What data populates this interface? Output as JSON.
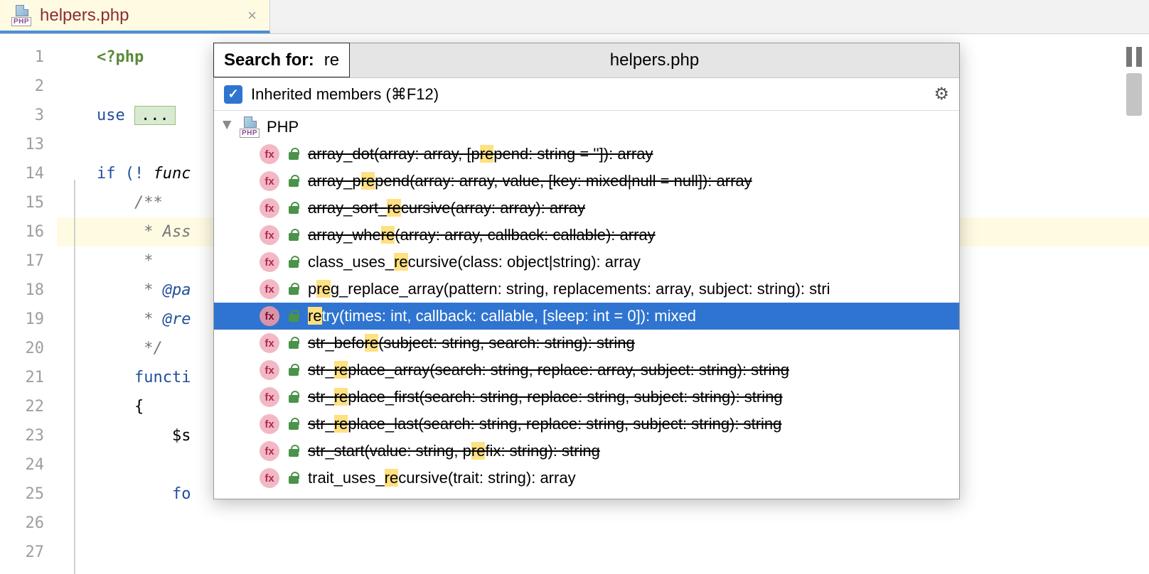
{
  "tab": {
    "filename": "helpers.php",
    "icon_badge": "PHP"
  },
  "gutter_lines": [
    "1",
    "2",
    "3",
    "13",
    "14",
    "15",
    "16",
    "17",
    "18",
    "19",
    "20",
    "21",
    "22",
    "23",
    "24",
    "25",
    "26",
    "27"
  ],
  "code": {
    "l1_tag": "<?php",
    "l3_use": "use ",
    "l3_fold": "...",
    "l14_if": "if (! ",
    "l14_func": "func",
    "l15": "    /**",
    "l16": "     * Ass",
    "l17": "     *",
    "l18_a": "     * ",
    "l18_b": "@pa",
    "l19_a": "     * ",
    "l19_b": "@re",
    "l20": "     */",
    "l21": "    functi",
    "l22": "    {",
    "l23": "        $s",
    "l25": "        fo"
  },
  "popup": {
    "search_label": "Search for:",
    "query": "re",
    "title": "helpers.php",
    "inherited_label": "Inherited members (⌘F12)",
    "tree_root": "PHP",
    "root_badge": "PHP",
    "results": [
      {
        "pre": "array_dot(array: array, [p",
        "hi": "re",
        "post": "pend: string = '']): array",
        "strike": true,
        "selected": false
      },
      {
        "pre": "array_p",
        "hi": "re",
        "post": "pend(array: array, value, [key: mixed|null = null]): array",
        "strike": true,
        "selected": false
      },
      {
        "pre": "array_sort_",
        "hi": "re",
        "post": "cursive(array: array): array",
        "strike": true,
        "selected": false
      },
      {
        "pre": "array_whe",
        "hi": "re",
        "post": "(array: array, callback: callable): array",
        "strike": true,
        "selected": false
      },
      {
        "pre": "class_uses_",
        "hi": "re",
        "post": "cursive(class: object|string): array",
        "strike": false,
        "selected": false
      },
      {
        "pre": "p",
        "hi": "re",
        "post": "g_replace_array(pattern: string, replacements: array, subject: string): stri",
        "strike": false,
        "selected": false
      },
      {
        "pre": "",
        "hi": "re",
        "post": "try(times: int, callback: callable, [sleep: int = 0]): mixed",
        "strike": false,
        "selected": true
      },
      {
        "pre": "str_befo",
        "hi": "re",
        "post": "(subject: string, search: string): string",
        "strike": true,
        "selected": false
      },
      {
        "pre": "str_",
        "hi": "re",
        "post": "place_array(search: string, replace: array, subject: string): string",
        "strike": true,
        "selected": false
      },
      {
        "pre": "str_",
        "hi": "re",
        "post": "place_first(search: string, replace: string, subject: string): string",
        "strike": true,
        "selected": false
      },
      {
        "pre": "str_",
        "hi": "re",
        "post": "place_last(search: string, replace: string, subject: string): string",
        "strike": true,
        "selected": false
      },
      {
        "pre": "str_start(value: string, p",
        "hi": "re",
        "post": "fix: string): string",
        "strike": true,
        "selected": false
      },
      {
        "pre": "trait_uses_",
        "hi": "re",
        "post": "cursive(trait: string): array",
        "strike": false,
        "selected": false
      }
    ]
  }
}
